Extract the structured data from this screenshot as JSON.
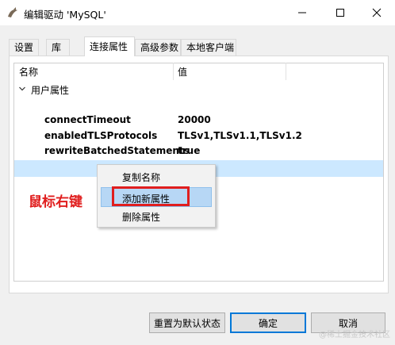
{
  "window": {
    "title": "编辑驱动 'MySQL'"
  },
  "tabs": [
    {
      "label": "设置"
    },
    {
      "label": "库"
    },
    {
      "label": "连接属性"
    },
    {
      "label": "高级参数"
    },
    {
      "label": "本地客户端"
    }
  ],
  "active_tab": "连接属性",
  "table": {
    "columns": [
      "名称",
      "值"
    ],
    "group_label": "用户属性",
    "rows": [
      {
        "name": "connectTimeout",
        "value": "20000"
      },
      {
        "name": "enabledTLSProtocols",
        "value": "TLSv1,TLSv1.1,TLSv1.2"
      },
      {
        "name": "rewriteBatchedStatements",
        "value": "true"
      }
    ]
  },
  "context_menu": {
    "items": [
      "复制名称",
      "添加新属性",
      "删除属性"
    ],
    "highlighted": "添加新属性"
  },
  "annotation": "鼠标右键",
  "buttons": {
    "reset": "重置为默认状态",
    "ok": "确定",
    "cancel": "取消"
  },
  "watermark": "@稀土掘金技术社区",
  "colors": {
    "selection": "#cce8ff",
    "menu_highlight": "#b7d7f5",
    "annotation_red": "#e01e1e",
    "primary_border": "#0078d7"
  }
}
